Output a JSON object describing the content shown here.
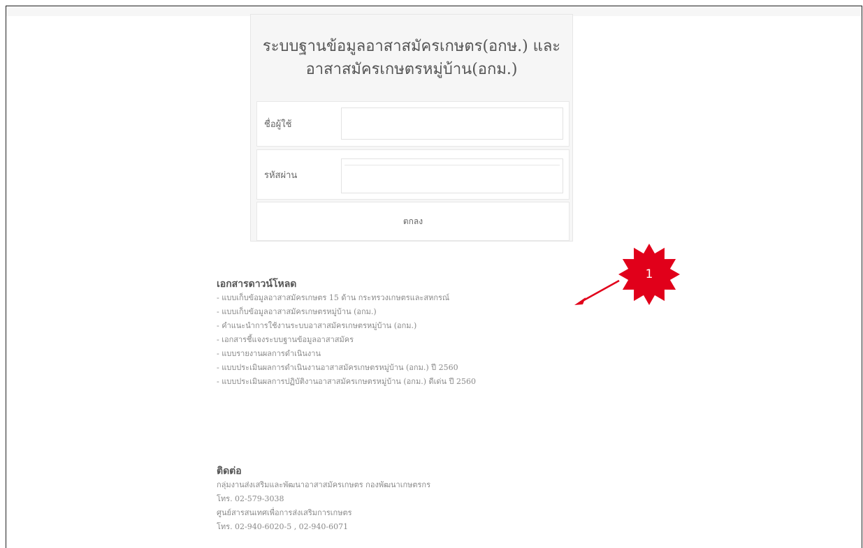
{
  "login": {
    "title_line1": "ระบบฐานข้อมูลอาสาสมัครเกษตร(อกษ.) และ",
    "title_line2": "อาสาสมัครเกษตรหมู่บ้าน(อกม.)",
    "username_label": "ชื่อผู้ใช้",
    "username_value": "",
    "password_label": "รหัสผ่าน",
    "password_value": "",
    "submit_label": "ตกลง"
  },
  "annotation": {
    "number": "1",
    "color": "#e1001a"
  },
  "documents": {
    "heading": "เอกสารดาวน์โหลด",
    "links": [
      "- แบบเก็บข้อมูลอาสาสมัครเกษตร 15 ด้าน กระทรวงเกษตรและสหกรณ์",
      "- แบบเก็บข้อมูลอาสาสมัครเกษตรหมู่บ้าน (อกม.)",
      "- คำแนะนำการใช้งานระบบอาสาสมัครเกษตรหมู่บ้าน (อกม.)",
      "- เอกสารชี้แจงระบบฐานข้อมูลอาสาสมัคร",
      "- แบบรายงานผลการดำเนินงาน",
      "- แบบประเมินผลการดำเนินงานอาสาสมัครเกษตรหมู่บ้าน (อกม.) ปี 2560",
      "- แบบประเมินผลการปฏิบัติงานอาสาสมัครเกษตรหมู่บ้าน (อกม.) ดีเด่น ปี 2560"
    ]
  },
  "contact": {
    "heading": "ติดต่อ",
    "lines": [
      "กลุ่มงานส่งเสริมและพัฒนาอาสาสมัครเกษตร กองพัฒนาเกษตรกร",
      "โทร. 02-579-3038",
      "ศูนย์สารสนเทศเพื่อการส่งเสริมการเกษตร",
      "โทร. 02-940-6020-5 , 02-940-6071"
    ]
  }
}
